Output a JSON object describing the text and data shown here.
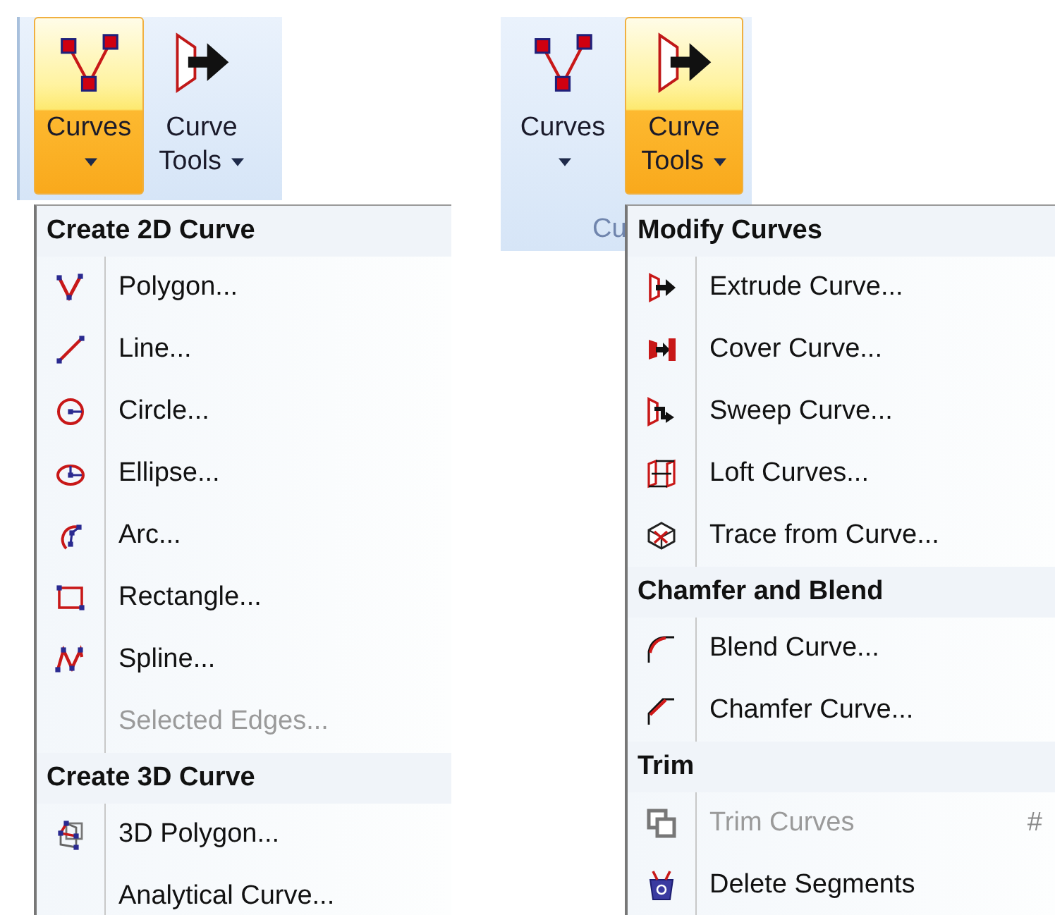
{
  "panels": [
    {
      "ribbon": {
        "buttons": [
          {
            "label": "Curves",
            "selected": true
          },
          {
            "label": "Curve Tools",
            "selected": false
          }
        ]
      },
      "menu": {
        "sections": [
          {
            "header": "Create 2D Curve",
            "items": [
              {
                "label": "Polygon...",
                "disabled": false
              },
              {
                "label": "Line...",
                "disabled": false
              },
              {
                "label": "Circle...",
                "disabled": false
              },
              {
                "label": "Ellipse...",
                "disabled": false
              },
              {
                "label": "Arc...",
                "disabled": false
              },
              {
                "label": "Rectangle...",
                "disabled": false
              },
              {
                "label": "Spline...",
                "disabled": false
              },
              {
                "label": "Selected Edges...",
                "disabled": true
              }
            ]
          },
          {
            "header": "Create 3D Curve",
            "items": [
              {
                "label": "3D Polygon...",
                "disabled": false
              },
              {
                "label": "Analytical Curve...",
                "disabled": false
              }
            ]
          }
        ]
      }
    },
    {
      "ribbon": {
        "buttons": [
          {
            "label": "Curves",
            "selected": false
          },
          {
            "label": "Curve Tools",
            "selected": true
          }
        ],
        "group_label": "Cu"
      },
      "menu": {
        "sections": [
          {
            "header": "Modify Curves",
            "items": [
              {
                "label": "Extrude Curve...",
                "disabled": false
              },
              {
                "label": "Cover Curve...",
                "disabled": false
              },
              {
                "label": "Sweep Curve...",
                "disabled": false
              },
              {
                "label": "Loft Curves...",
                "disabled": false
              },
              {
                "label": "Trace from Curve...",
                "disabled": false
              }
            ]
          },
          {
            "header": "Chamfer and Blend",
            "items": [
              {
                "label": "Blend Curve...",
                "disabled": false
              },
              {
                "label": "Chamfer Curve...",
                "disabled": false
              }
            ]
          },
          {
            "header": "Trim",
            "items": [
              {
                "label": "Trim Curves",
                "disabled": true,
                "shortcut": "#"
              },
              {
                "label": "Delete Segments",
                "disabled": false
              }
            ]
          }
        ]
      }
    }
  ]
}
